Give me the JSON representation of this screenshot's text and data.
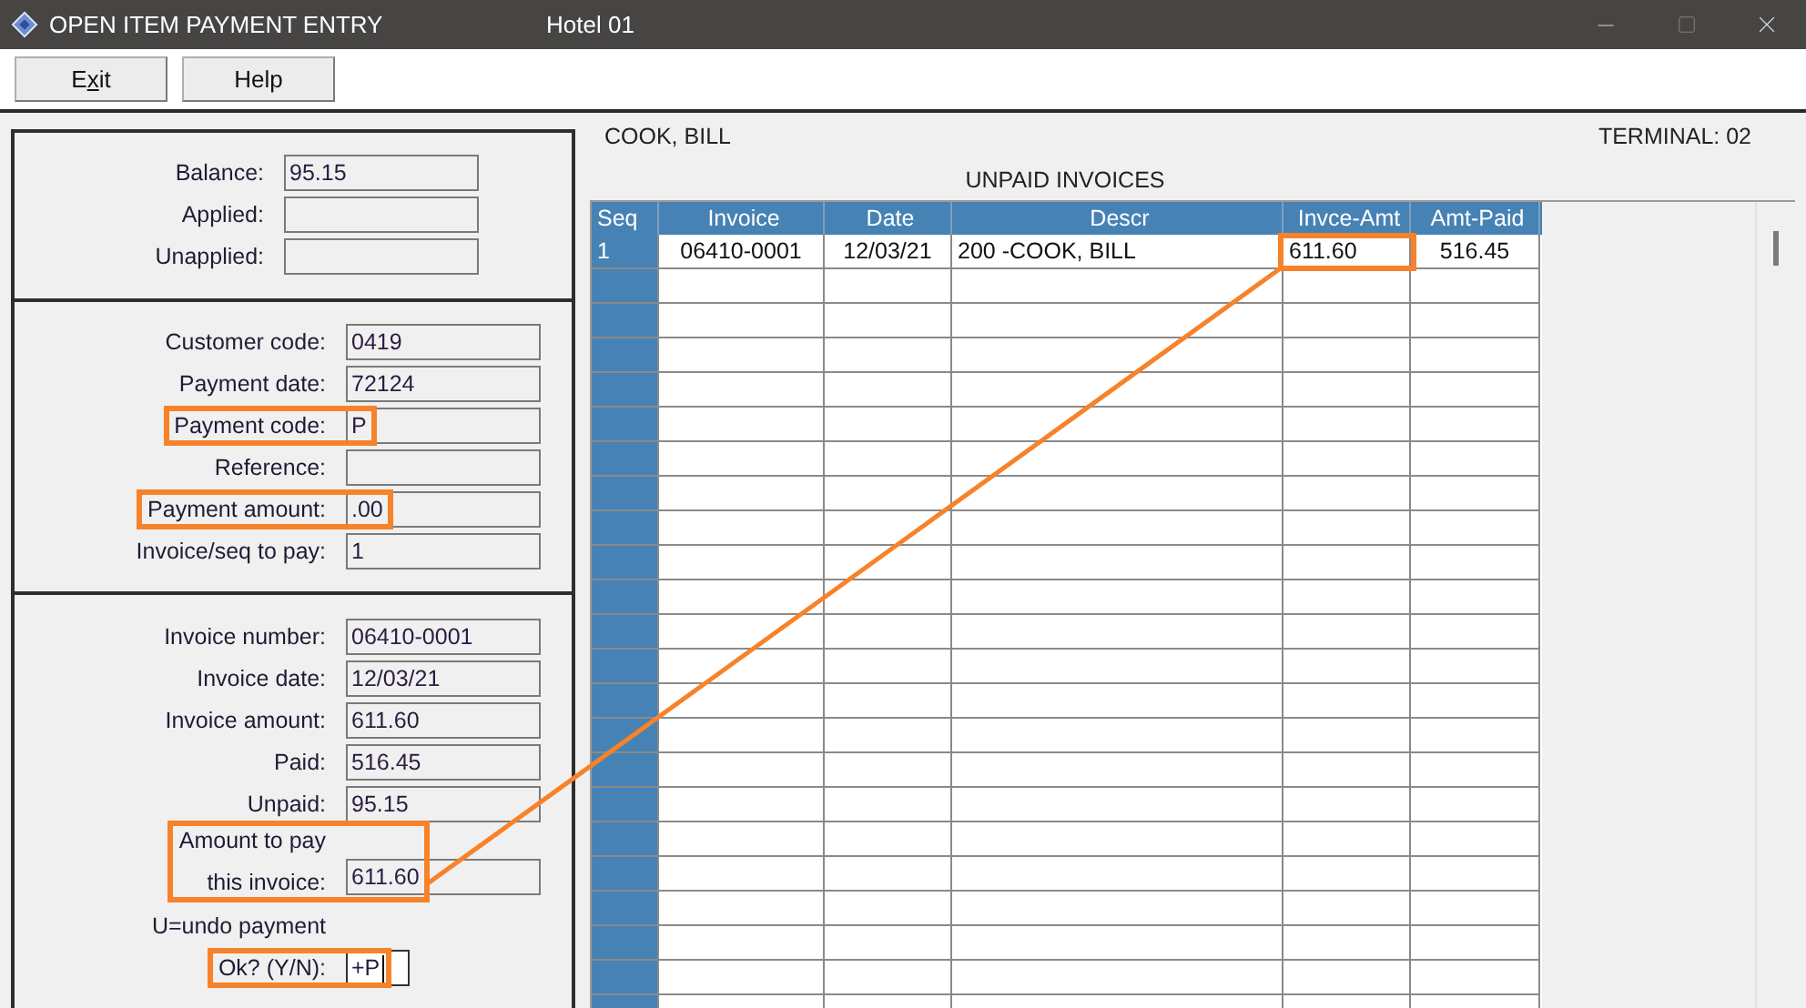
{
  "window": {
    "title": "OPEN ITEM PAYMENT ENTRY",
    "subtitle": "Hotel 01"
  },
  "toolbar": [
    {
      "before": "E",
      "mnemonic": "x",
      "after": "it"
    },
    {
      "before": "Help"
    }
  ],
  "totals": [
    {
      "label": "Balance:",
      "value": "95.15"
    },
    {
      "label": "Applied:"
    },
    {
      "label": "Unapplied:"
    }
  ],
  "payment": [
    {
      "label": "Customer code:",
      "value": "0419",
      "highlighted": false
    },
    {
      "label": "Payment date:",
      "value": "72124",
      "highlighted": false
    },
    {
      "label": "Payment code:",
      "value": "P",
      "highlighted": true,
      "linked": false
    },
    {
      "label": "Reference:",
      "highlighted": false
    },
    {
      "label": "Payment amount:",
      "value": ".00",
      "highlighted": true,
      "linked": false
    },
    {
      "label": "Invoice/seq to pay:",
      "value": "1",
      "highlighted": false
    }
  ],
  "invoice": [
    {
      "label": "Invoice number:",
      "value": "06410-0001",
      "highlighted": false
    },
    {
      "label": "Invoice date:",
      "value": "12/03/21",
      "highlighted": false
    },
    {
      "label": "Invoice amount:",
      "value": "611.60",
      "highlighted": false
    },
    {
      "label": "Paid:",
      "value": "516.45",
      "highlighted": false
    },
    {
      "label": "Unpaid:",
      "value": "95.15",
      "highlighted": false
    },
    {
      "label": "Amount to pay",
      "label_2": "this invoice:",
      "value": "611.60",
      "highlighted": true,
      "linked": true
    }
  ],
  "undo_hint": "U=undo payment",
  "confirm": {
    "label": "Ok? (Y/N):",
    "value": "+P",
    "highlighted": true,
    "linked": false,
    "focused": true
  },
  "customer_name": "COOK, BILL",
  "terminal": "TERMINAL: 02",
  "table": {
    "title": "UNPAID INVOICES",
    "columns": [
      "Seq",
      "Invoice",
      "Date",
      "Descr",
      "Invce-Amt",
      "Amt-Paid"
    ],
    "rows": [
      {
        "cells": [
          {
            "text": "1",
            "highlighted": false
          },
          {
            "text": "06410-0001",
            "highlighted": false
          },
          {
            "text": "12/03/21",
            "highlighted": false
          },
          {
            "text": "200 -COOK, BILL",
            "highlighted": false
          },
          {
            "text": "611.60",
            "highlighted": true,
            "linked": true
          },
          {
            "text": "516.45",
            "highlighted": false
          }
        ]
      }
    ]
  },
  "leader_line": true
}
